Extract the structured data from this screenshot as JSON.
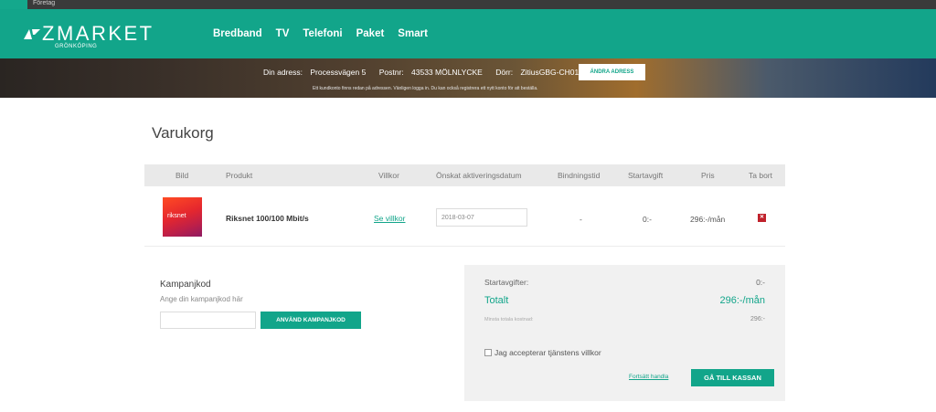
{
  "browser_bar": {
    "tabs": [
      "Hem",
      "Företag"
    ],
    "right_items": [
      "",
      "",
      "",
      ""
    ]
  },
  "brand": {
    "name": "ZMARKET",
    "sub": "GRÖNKÖPING",
    "logo_icon": "zmarket-logo-icon",
    "color_primary": "#12a58a"
  },
  "nav": {
    "items": [
      "Bredband",
      "TV",
      "Telefoni",
      "Paket",
      "Smart"
    ]
  },
  "address_banner": {
    "address_label": "Din adress:",
    "address_value": "Processvägen 5",
    "postnr_label": "Postnr:",
    "postnr_value": "43533 MÖLNLYCKE",
    "door_label": "Dörr:",
    "door_value": "ZitiusGBG-CH01",
    "change_button": "ÄNDRA ADRESS",
    "notice": "Ett kundkonto finns redan på adressen. Vänligen logga in. Du kan också registrera ett nytt konto för att beställa."
  },
  "cart": {
    "title": "Varukorg",
    "columns": [
      "Bild",
      "Produkt",
      "Villkor",
      "Önskat aktiveringsdatum",
      "Bindningstid",
      "Startavgift",
      "Pris",
      "Ta bort"
    ],
    "rows": [
      {
        "image_text": "riksnet",
        "product": "Riksnet 100/100 Mbit/s",
        "terms_link": "Se villkor",
        "activation_date": "2018-03-07",
        "binding": "-",
        "start_fee": "0:-",
        "price": "296:-/mån",
        "remove_icon": "close-icon"
      }
    ]
  },
  "campaign": {
    "title": "Kampanjkod",
    "hint": "Ange din kampanjkod här",
    "input_value": "",
    "apply_button": "ANVÄND KAMPANJKOD"
  },
  "summary": {
    "start_fees_label": "Startavgifter:",
    "start_fees_value": "0:-",
    "total_label": "Totalt",
    "total_value": "296:-/mån",
    "min_cost_label": "Minsta totala kostnad:",
    "min_cost_value": "296:-",
    "accept_label": "Jag accepterar tjänstens villkor",
    "accept_checked": false,
    "continue_link": "Fortsätt handla",
    "checkout_button": "GÅ TILL KASSAN"
  }
}
